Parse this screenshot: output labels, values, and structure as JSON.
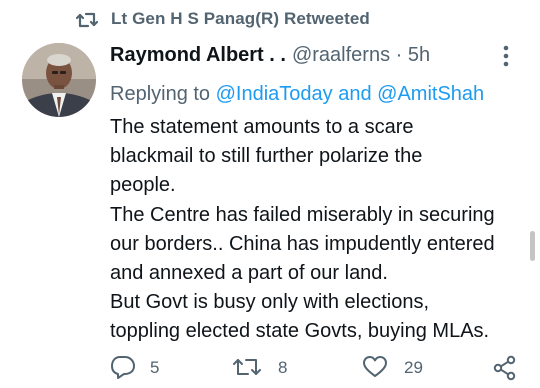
{
  "retweet_banner": {
    "text": "Lt Gen H S Panag(R) Retweeted",
    "icon": "retweet-icon"
  },
  "tweet": {
    "author_name": "Raymond Albert . .",
    "handle_time": "@raalferns · 5h",
    "replying_prefix": "Replying to",
    "replying_to": "@IndiaToday and @AmitShah",
    "body_lines": [
      "The statement amounts to a scare",
      "blackmail to still further polarize the",
      "people.",
      "The Centre has failed miserably in securing",
      "our borders.. China has impudently entered",
      "and annexed a part of our land.",
      "But Govt is busy only with elections,",
      "toppling elected state Govts, buying MLAs."
    ],
    "more_icon": "more-vertical-icon"
  },
  "actions": {
    "reply": {
      "icon": "reply-icon",
      "count": "5"
    },
    "retweet": {
      "icon": "retweet-icon",
      "count": "8"
    },
    "like": {
      "icon": "heart-icon",
      "count": "29"
    },
    "share": {
      "icon": "share-icon"
    }
  },
  "colors": {
    "text_primary": "#0f1419",
    "text_secondary": "#536471",
    "link": "#1d9bf0",
    "background": "#ffffff"
  }
}
